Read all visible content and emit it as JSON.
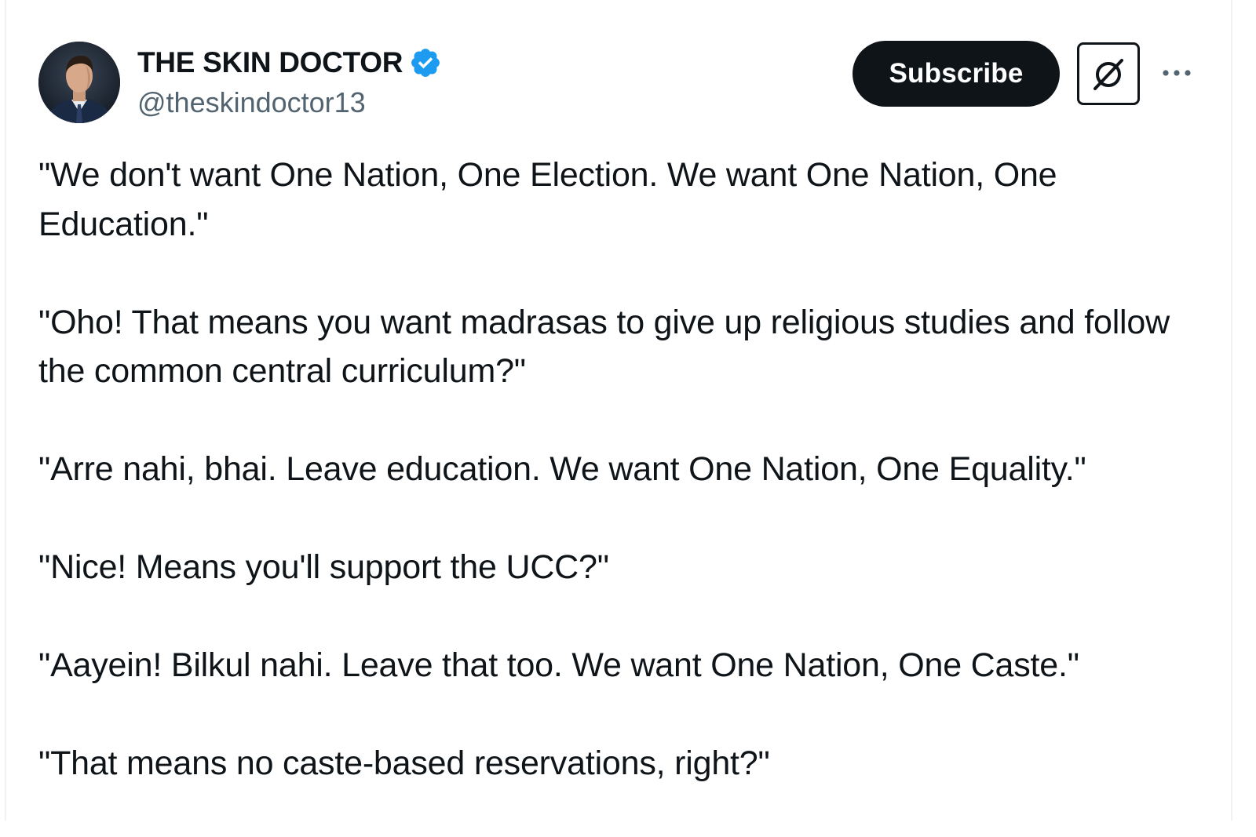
{
  "author": {
    "display_name": "THE SKIN DOCTOR",
    "handle": "@theskindoctor13",
    "verified": true,
    "avatar_icon": "profile-photo-icon"
  },
  "actions": {
    "subscribe_label": "Subscribe",
    "grok_icon": "grok-icon",
    "more_icon": "more-options-icon"
  },
  "colors": {
    "text_primary": "#0f1419",
    "text_secondary": "#536471",
    "verified_blue": "#1d9bf0",
    "button_dark": "#0f1419"
  },
  "tweet": {
    "paragraphs": [
      "\"We don't want One Nation, One Election. We want One Nation, One Education.\"",
      "\"Oho! That means you want madrasas to give up religious studies and follow the common central curriculum?\"",
      "\"Arre nahi, bhai. Leave education. We want One Nation, One Equality.\"",
      "\"Nice! Means you'll support the UCC?\"",
      "\"Aayein! Bilkul nahi. Leave that too. We want One Nation, One Caste.\"",
      "\"That means no caste-based reservations, right?\""
    ]
  }
}
